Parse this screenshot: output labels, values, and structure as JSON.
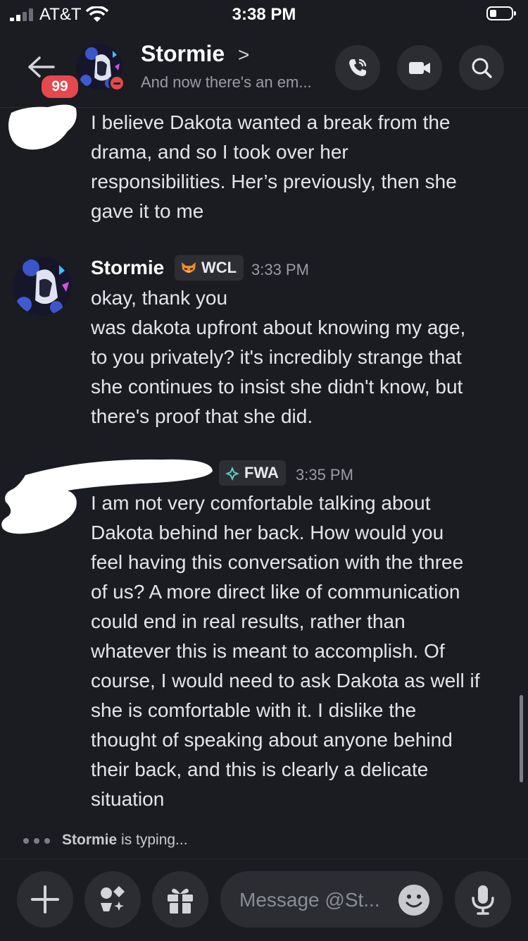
{
  "status_bar": {
    "carrier": "AT&T",
    "time": "3:38 PM"
  },
  "header": {
    "unread_badge": "99",
    "name": "Stormie",
    "chevron": ">",
    "subtitle": "And now there's an em..."
  },
  "messages": [
    {
      "id": "m1",
      "author_redacted": true,
      "text": "I believe Dakota wanted a break from the\ndrama, and so I took over her\nresponsibilities. Her’s previously, then she\ngave it to me"
    },
    {
      "id": "m2",
      "author": "Stormie",
      "tag": "WCL",
      "time": "3:33 PM",
      "text": "okay, thank you\nwas dakota upfront about knowing my age,\nto you privately? it's incredibly strange that\nshe continues to insist she didn't know, but\nthere's proof that she did."
    },
    {
      "id": "m3",
      "author_redacted": true,
      "tag": "FWA",
      "time": "3:35 PM",
      "text": "I am not very comfortable talking about\nDakota behind her back. How would you\nfeel having this conversation with the three\nof us? A more direct like of communication\ncould end in real results, rather than\nwhatever this is meant to accomplish. Of\ncourse, I would need to ask Dakota as well if\nshe is comfortable with it. I dislike the\nthought of speaking about anyone behind\ntheir back, and this is clearly a delicate\nsituation"
    }
  ],
  "typing": {
    "user": "Stormie",
    "suffix": " is typing..."
  },
  "composer": {
    "placeholder": "Message @St..."
  },
  "icons": [
    "back-arrow-icon",
    "phone-icon",
    "video-icon",
    "search-icon",
    "plus-icon",
    "apps-icon",
    "gift-icon",
    "emoji-icon",
    "microphone-icon"
  ],
  "colors": {
    "background": "#1b1c21",
    "button": "#2b2d33",
    "badge_red": "#e5484d",
    "muted_text": "#9a9ca5"
  }
}
